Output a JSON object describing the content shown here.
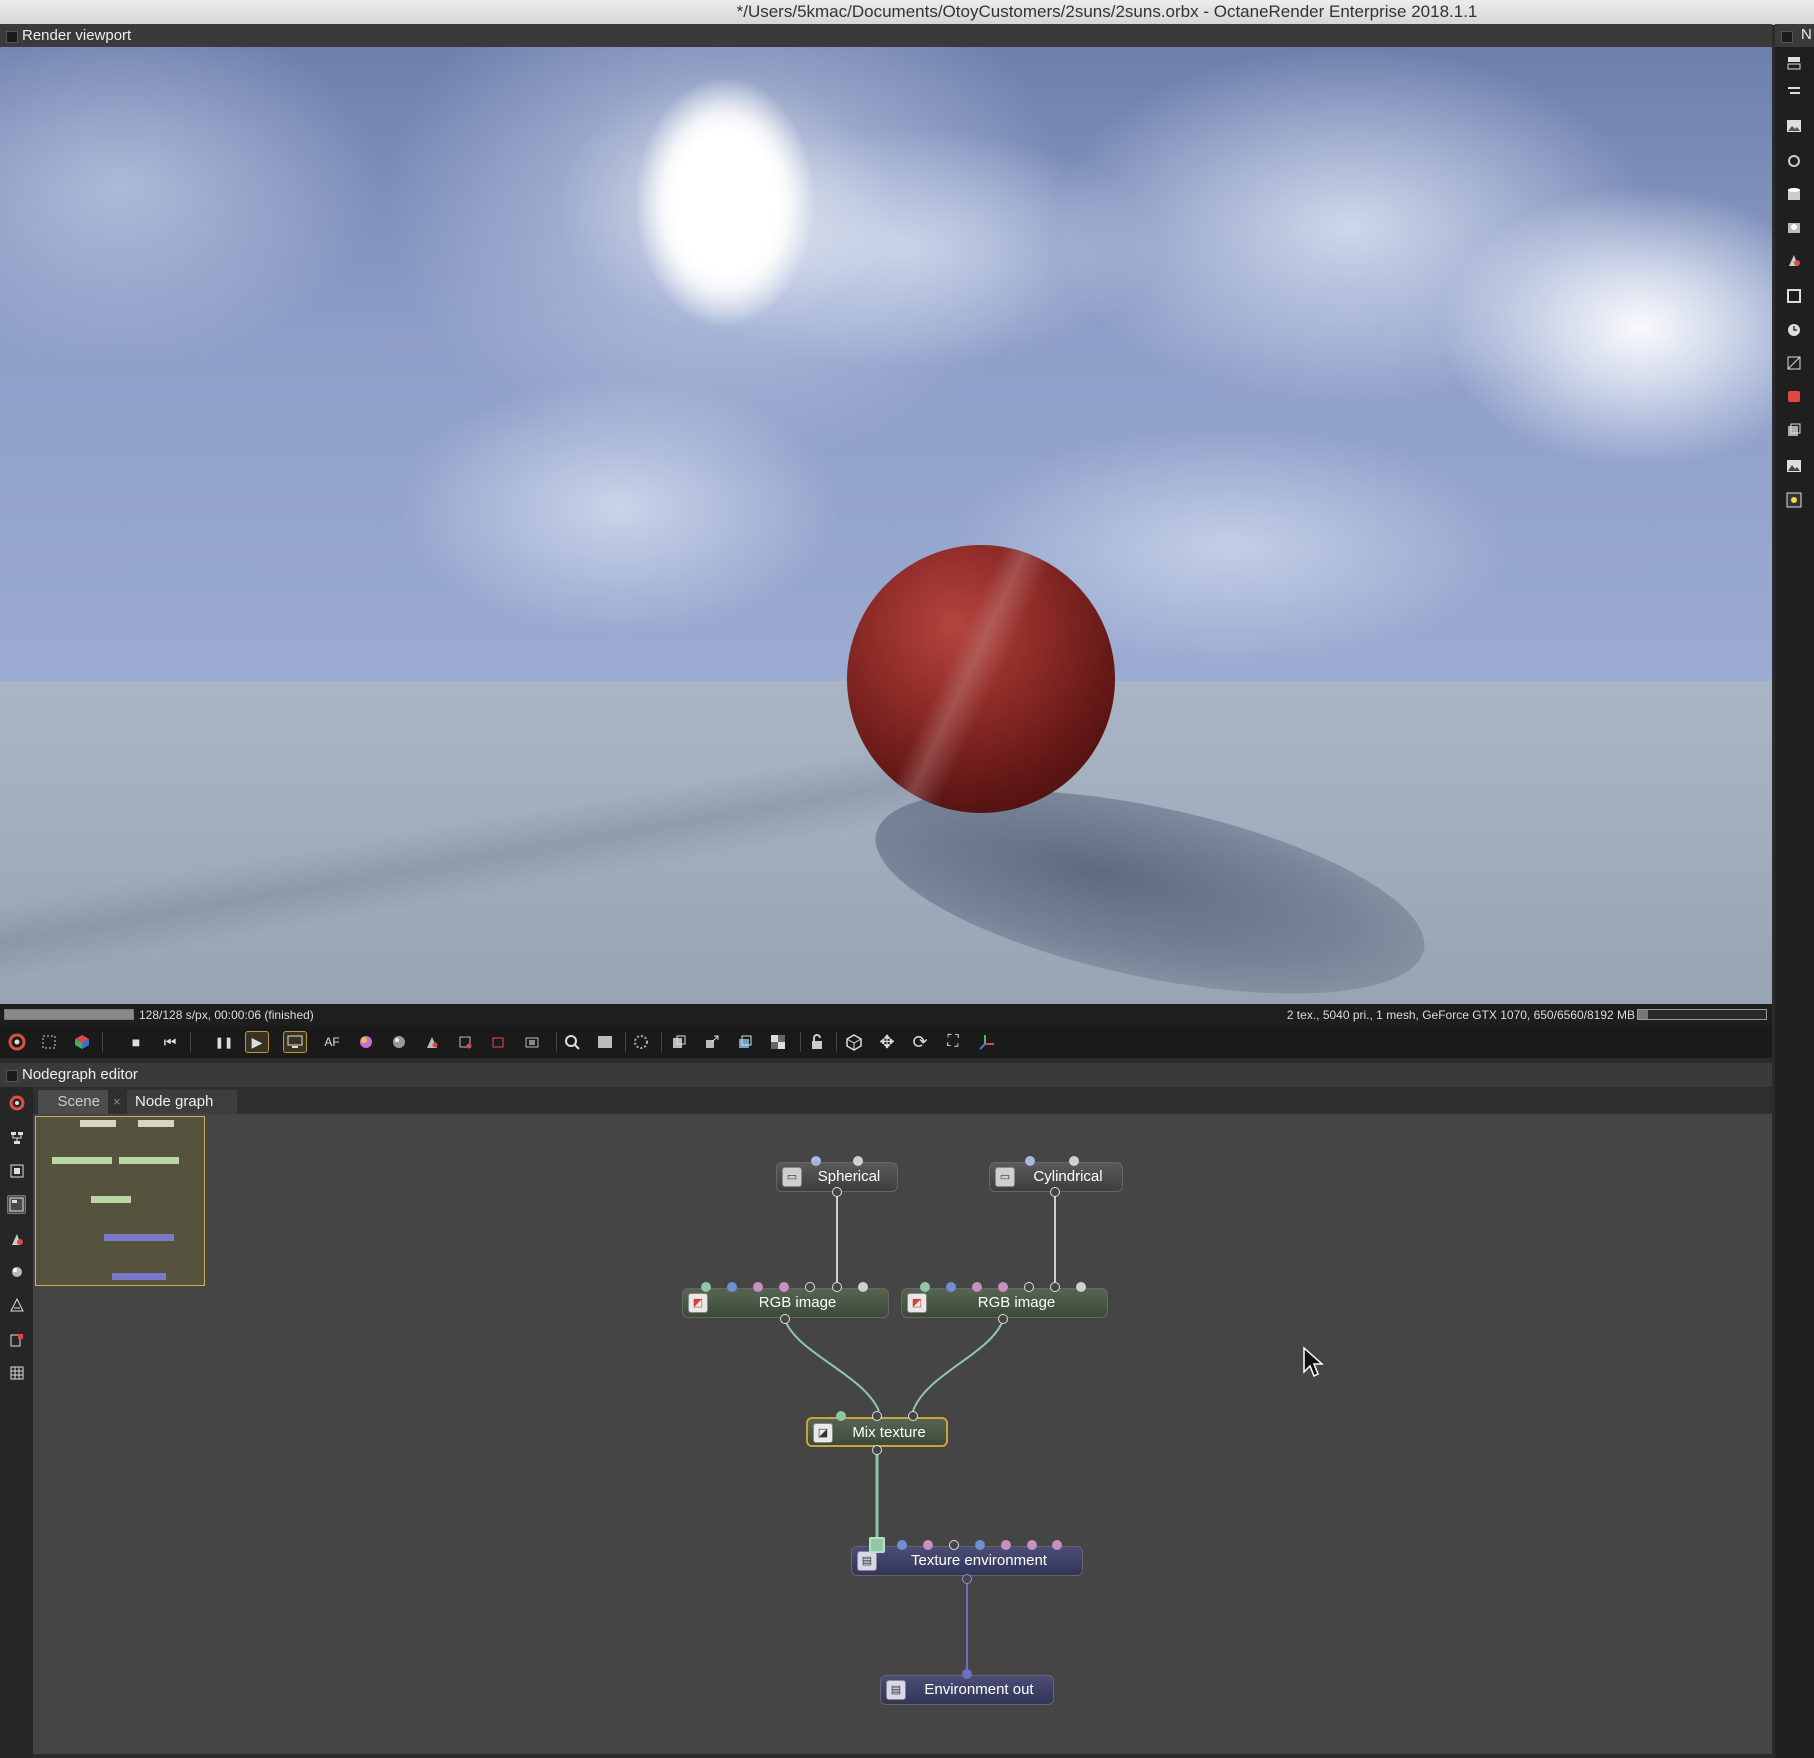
{
  "window": {
    "title": "*/Users/5kmac/Documents/OtoyCustomers/2suns/2suns.orbx - OctaneRender Enterprise 2018.1.1"
  },
  "render_viewport": {
    "header": "Render viewport",
    "progress_fraction": 1.0,
    "status": "128/128 s/px, 00:00:06 (finished)",
    "stats": "2 tex., 5040 pri., 1 mesh, GeForce GTX 1070, 650/6560/8192 MB",
    "memory_fraction": 0.08
  },
  "toolbar": {
    "buttons": [
      {
        "icon": "octane-logo-icon"
      },
      {
        "icon": "fit-view-icon"
      },
      {
        "icon": "cube-color-icon"
      },
      {
        "icon": "stop-icon",
        "glyph": "■"
      },
      {
        "icon": "restart-icon",
        "glyph": "⏮"
      },
      {
        "icon": "pause-icon",
        "glyph": "❚❚"
      },
      {
        "icon": "play-icon",
        "glyph": "▶"
      },
      {
        "icon": "realtime-icon"
      },
      {
        "icon": "af-icon",
        "label": "AF"
      },
      {
        "icon": "color-picker-icon"
      },
      {
        "icon": "material-picker-icon"
      },
      {
        "icon": "focus-picker-icon"
      },
      {
        "icon": "white-balance-icon"
      },
      {
        "icon": "region-icon"
      },
      {
        "icon": "film-region-icon"
      },
      {
        "icon": "zoom-icon"
      },
      {
        "icon": "crop-icon"
      },
      {
        "icon": "spinner-icon"
      },
      {
        "icon": "copy-icon"
      },
      {
        "icon": "export-icon"
      },
      {
        "icon": "layers-icon"
      },
      {
        "icon": "checker-icon"
      },
      {
        "icon": "lock-icon"
      },
      {
        "icon": "box-icon"
      },
      {
        "icon": "move-icon",
        "glyph": "✥"
      },
      {
        "icon": "rotate-icon",
        "glyph": "⟳"
      },
      {
        "icon": "scale-icon",
        "glyph": "⛶"
      },
      {
        "icon": "axis-icon"
      }
    ]
  },
  "right_dock": {
    "header_label": "N"
  },
  "nodegraph": {
    "header": "Nodegraph editor",
    "tabs": [
      {
        "label": "Scene"
      },
      {
        "label": "Node graph"
      }
    ],
    "tab_close": "×",
    "nodes": [
      {
        "id": "spherical",
        "label": "Spherical"
      },
      {
        "id": "cylindrical",
        "label": "Cylindrical"
      },
      {
        "id": "rgb1",
        "label": "RGB image"
      },
      {
        "id": "rgb2",
        "label": "RGB image"
      },
      {
        "id": "mix",
        "label": "Mix texture"
      },
      {
        "id": "texenv",
        "label": "Texture environment"
      },
      {
        "id": "envout",
        "label": "Environment out"
      }
    ],
    "colors": {
      "texture_wire": "#8fc7a7",
      "env_wire": "#6d6fc4",
      "projection_wire": "#cfcfcf",
      "selected_border": "#c9a43a"
    }
  }
}
